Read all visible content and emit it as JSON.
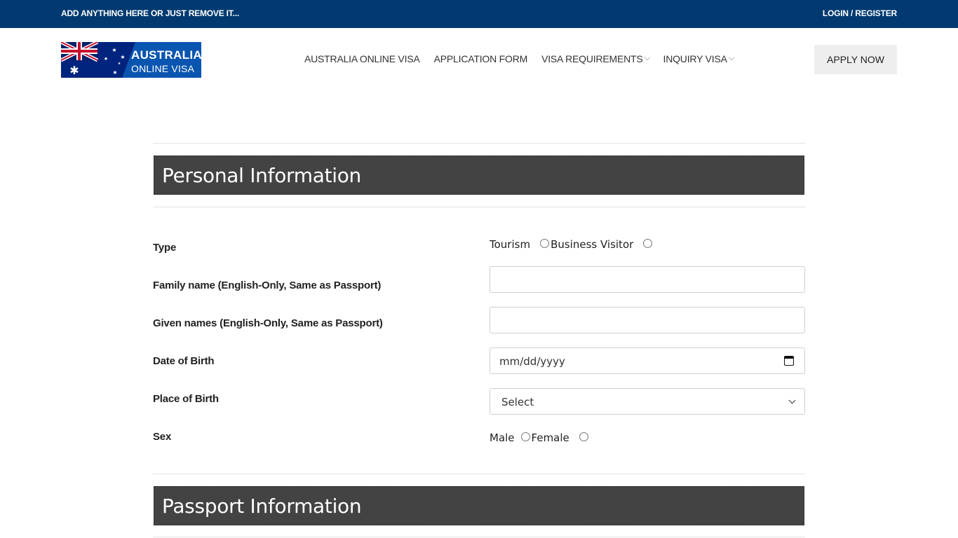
{
  "topbar": {
    "notice": "ADD ANYTHING HERE OR JUST REMOVE IT...",
    "auth_link": "LOGIN / REGISTER"
  },
  "logo": {
    "line1": "AUSTRALIA",
    "line2": "ONLINE VISA"
  },
  "nav": {
    "items": [
      {
        "label": "AUSTRALIA ONLINE VISA",
        "has_dropdown": false
      },
      {
        "label": "APPLICATION FORM",
        "has_dropdown": false
      },
      {
        "label": "VISA REQUIREMENTS",
        "has_dropdown": true
      },
      {
        "label": "INQUIRY VISA",
        "has_dropdown": true
      }
    ]
  },
  "apply_button": "APPLY NOW",
  "sections": {
    "personal": {
      "title": "Personal Information",
      "fields": {
        "type": {
          "label": "Type",
          "options": [
            "Tourism",
            "Business Visitor"
          ]
        },
        "family_name": {
          "label": "Family name (English-Only, Same as Passport)",
          "value": ""
        },
        "given_names": {
          "label": "Given names (English-Only, Same as Passport)",
          "value": ""
        },
        "dob": {
          "label": "Date of Birth",
          "placeholder": "mm/dd/yyyy"
        },
        "place_of_birth": {
          "label": "Place of Birth",
          "selected": "Select"
        },
        "sex": {
          "label": "Sex",
          "options": [
            "Male",
            "Female"
          ]
        }
      }
    },
    "passport": {
      "title": "Passport Information"
    }
  },
  "colors": {
    "topbar": "#003a70",
    "section_header": "#434343",
    "logo_bg": "#00247d"
  }
}
